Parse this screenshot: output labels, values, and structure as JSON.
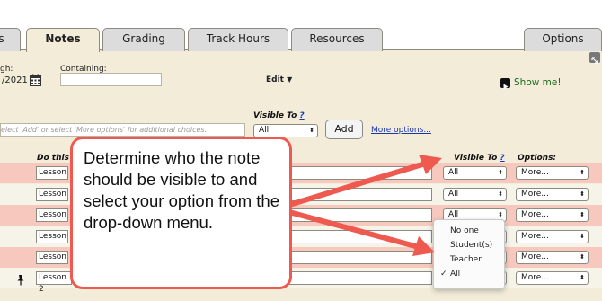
{
  "tabs": [
    {
      "label": "s"
    },
    {
      "label": "Notes"
    },
    {
      "label": "Grading"
    },
    {
      "label": "Track Hours"
    },
    {
      "label": "Resources"
    },
    {
      "label": "Options"
    }
  ],
  "filters": {
    "through_label": "gh:",
    "date_value": "/2021",
    "containing_label": "Containing:",
    "containing_value": "",
    "edit_label": "Edit",
    "show_me_label": "Show me!"
  },
  "add_bar": {
    "hint": "elect 'Add' or select 'More options' for additional choices.",
    "visible_to_label": "Visible To",
    "help_mark": "?",
    "visible_value": "All",
    "add_label": "Add",
    "more_options_link": "More options..."
  },
  "columns": {
    "do_this": "Do this",
    "visible_to": "Visible To",
    "help_mark": "?",
    "options": "Options:"
  },
  "rows": [
    {
      "lesson": "Lesson",
      "visible": "All",
      "options": "More..."
    },
    {
      "lesson": "Lesson",
      "visible": "All",
      "options": "More..."
    },
    {
      "lesson": "Lesson",
      "visible": "All",
      "options": "More..."
    },
    {
      "lesson": "Lesson",
      "visible": "",
      "options": "More..."
    },
    {
      "lesson": "Lesson",
      "visible": "",
      "options": "More..."
    },
    {
      "lesson": "Lesson 2",
      "visible": "",
      "options": "More..."
    }
  ],
  "dropdown": {
    "options": [
      "No one",
      "Student(s)",
      "Teacher",
      "All"
    ],
    "selected": "All"
  },
  "callout": {
    "text": "Determine who the note should be visible to and select your option from the drop-down menu."
  },
  "colors": {
    "accent_red": "#ee5a4f",
    "row_pink": "#f7c8bd",
    "background": "#f3ecd9"
  }
}
